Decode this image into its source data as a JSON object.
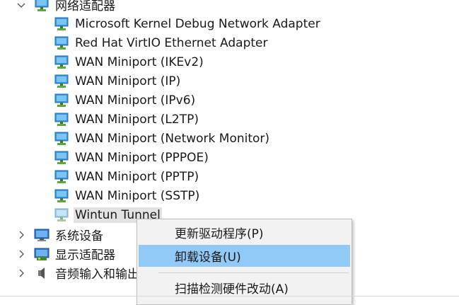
{
  "tree": {
    "category": {
      "label": "网络适配器",
      "expanded": true,
      "icon": "network-adapter-icon"
    },
    "adapters": [
      "Microsoft Kernel Debug Network Adapter",
      "Red Hat VirtIO Ethernet Adapter",
      "WAN Miniport (IKEv2)",
      "WAN Miniport (IP)",
      "WAN Miniport (IPv6)",
      "WAN Miniport (L2TP)",
      "WAN Miniport (Network Monitor)",
      "WAN Miniport (PPPOE)",
      "WAN Miniport (PPTP)",
      "WAN Miniport (SSTP)",
      "Wintun Tunnel"
    ],
    "selected_adapter": "Wintun Tunnel",
    "other_categories": [
      {
        "label": "系统设备",
        "icon": "system-devices-icon"
      },
      {
        "label": "显示适配器",
        "icon": "display-adapter-icon"
      },
      {
        "label": "音频输入和输出",
        "icon": "audio-io-icon"
      }
    ]
  },
  "context_menu": {
    "items": [
      {
        "label": "更新驱动程序(P)",
        "highlighted": false
      },
      {
        "label": "卸载设备(U)",
        "highlighted": true
      },
      {
        "label": "扫描检测硬件改动(A)",
        "highlighted": false
      }
    ]
  },
  "colors": {
    "menu_highlight": "#91c9f7",
    "menu_bg": "#f2f2f2",
    "selection_bg": "#e3e3e3"
  }
}
